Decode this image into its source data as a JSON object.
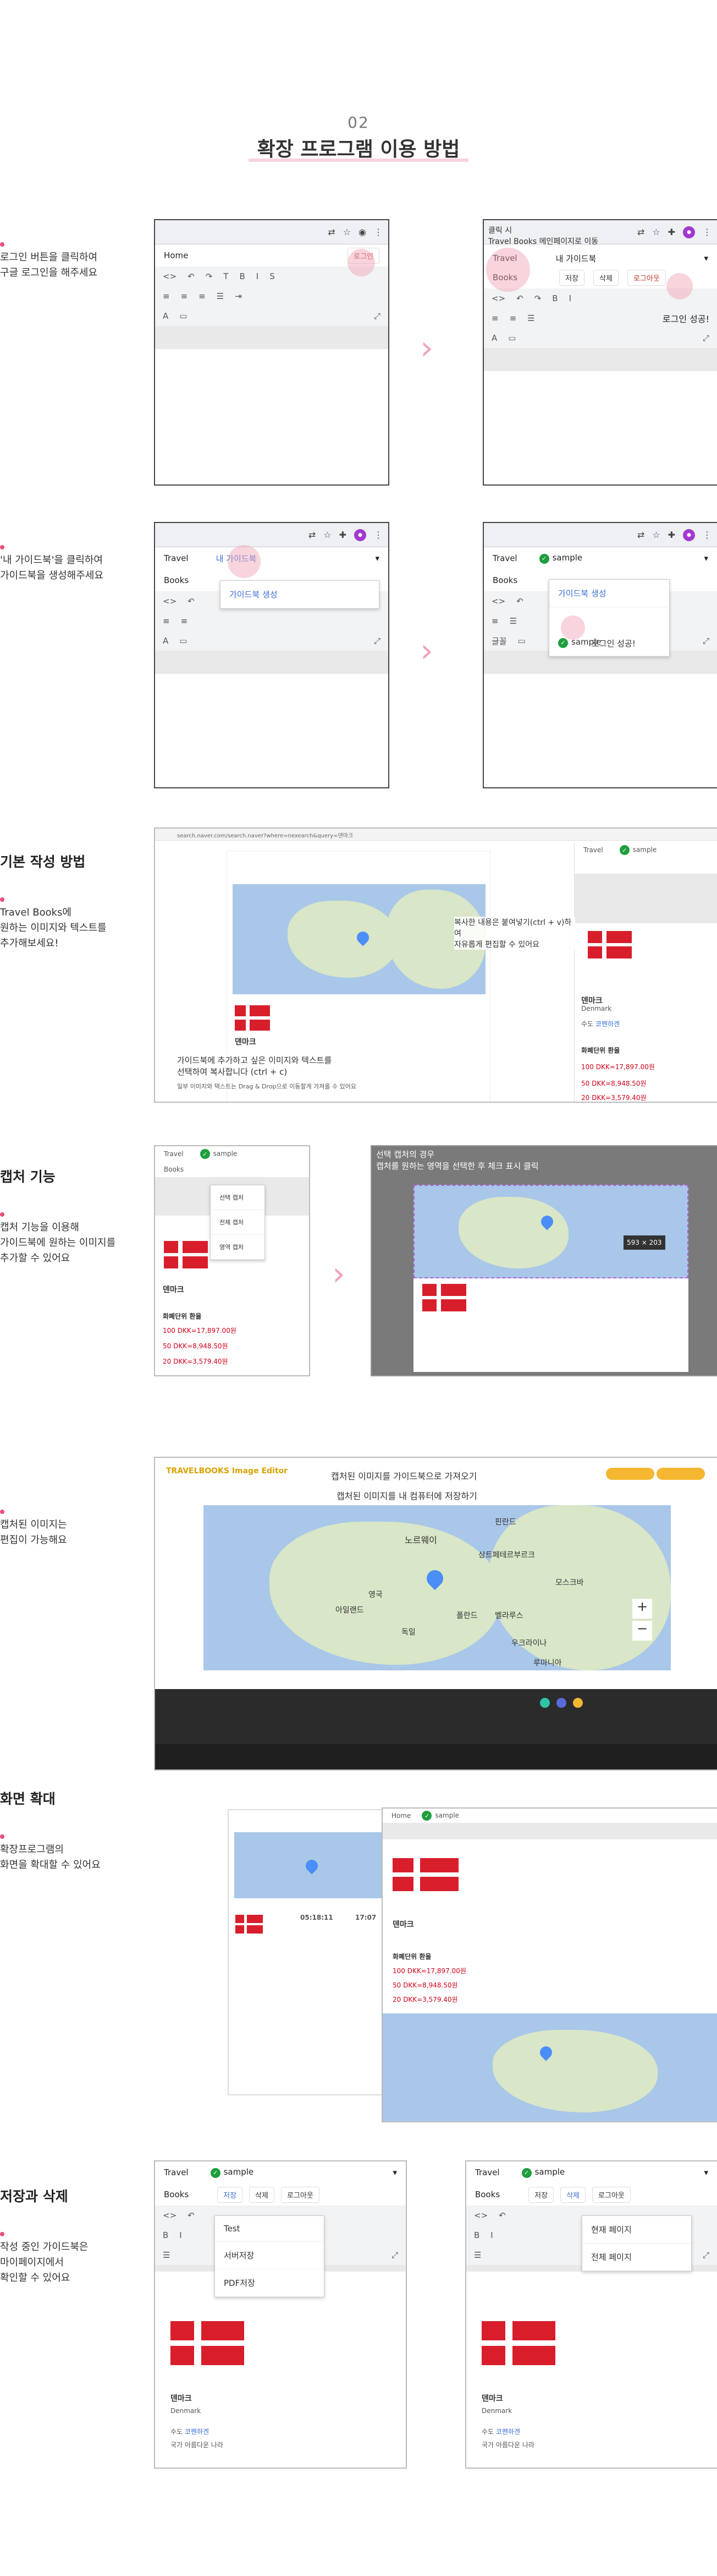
{
  "header": {
    "number": "02",
    "title": "확장 프로그램 이용 방법"
  },
  "step1": {
    "desc": "로그인 버튼을 클릭하여\n구글 로그인을 해주세요",
    "left": {
      "home": "Home",
      "login_btn": "로그인"
    },
    "right": {
      "note": "클릭 시\nTravel Books 메인페이지로 이동",
      "travel": "Travel",
      "books": "Books",
      "my_guide": "내 가이드북",
      "save": "저장",
      "delete": "삭제",
      "logout": "로그아웃",
      "success": "로그인 성공!"
    }
  },
  "step2": {
    "desc": "'내 가이드북'을 클릭하여\n가이드북을 생성해주세요",
    "left": {
      "travel": "Travel",
      "books": "Books",
      "my_guide": "내 가이드북",
      "create": "가이드북 생성"
    },
    "right": {
      "travel": "Travel",
      "books": "Books",
      "sample": "sample",
      "create": "가이드북 생성",
      "sample_item": "sample",
      "success": "로그인 성공!",
      "body_label": "글꼴"
    }
  },
  "step3": {
    "title": "기본 작성 방법",
    "desc": "Travel Books에\n원하는 이미지와 텍스트를\n추가해보세요!",
    "paste_note": "복사한 내용은 붙여넣기(ctrl + v)하여\n자유롭게 편집할 수 있어요",
    "copy_note": "가이드북에 추가하고 싶은 이미지와 텍스트를\n선택하여 복사합니다 (ctrl + c)",
    "copy_sub": "일부 이미지와 텍스트는 Drag & Drop으로 이동할게 가져올 수 있어요",
    "country": "덴마크",
    "country_en": "Denmark",
    "capital_label": "수도",
    "capital": "코펜하겐",
    "currency_title": "화폐단위 환율",
    "rates": [
      "100 DKK=17,897.00원",
      "50 DKK=8,948.50원",
      "20 DKK=3,579.40원"
    ],
    "url": "search.naver.com/search.naver?where=nexearch&query=덴마크"
  },
  "step4": {
    "title": "캡처 기능",
    "desc": "캡처 기능을 이용해\n가이드북에 원하는 이미지를\n추가할 수 있어요",
    "menu": [
      "선택 캡처",
      "전체 캡처",
      "영역 캡처"
    ],
    "tip": "선택 캡처의 경우\n캡처를 원하는 영역을 선택한 후 체크 표시 클릭",
    "size": "593 × 203",
    "country": "덴마크",
    "currency_title": "화폐단위 환율",
    "rates": [
      "100 DKK=17,897.00원",
      "50 DKK=8,948.50원",
      "20 DKK=3,579.40원"
    ]
  },
  "step5": {
    "desc": "캡처된 이미지는\n편집이 가능해요",
    "app_name": "TRAVELBOOKS Image Editor",
    "import_note": "캡처된 이미지를 가이드북으로 가져오기",
    "save_note": "캡처된 이미지를 내 컴퓨터에 저장하기",
    "cities": [
      "노르웨이",
      "핀란드",
      "상트페테르부르크",
      "영국",
      "아일랜드",
      "모스크바",
      "벨라루스",
      "폴란드",
      "우크라이나",
      "독일",
      "루마니아"
    ],
    "palette": [
      "#2ec4a6",
      "#5a6bd8",
      "#f5b731"
    ]
  },
  "step6": {
    "title": "화면 확대",
    "desc": "확장프로그램의\n화면을 확대할 수 있어요",
    "home": "Home",
    "sample": "sample",
    "country": "덴마크",
    "time1": "05:18:11",
    "time2": "17:07",
    "currency_title": "화폐단위 환율",
    "rates": [
      "100 DKK=17,897.00원",
      "50 DKK=8,948.50원",
      "20 DKK=3,579.40원"
    ]
  },
  "step7": {
    "title": "저장과 삭제",
    "desc": "작성 중인 가이드북은\n마이페이지에서\n확인할 수 있어요",
    "travel": "Travel",
    "books": "Books",
    "sample": "sample",
    "save": "저장",
    "delete": "삭제",
    "logout": "로그아웃",
    "save_menu": [
      "Test",
      "서버저장",
      "PDF저장"
    ],
    "delete_menu": [
      "현재 페이지",
      "전체 페이지"
    ],
    "country": "덴마크",
    "country_en": "Denmark",
    "capital_label": "수도",
    "capital": "코펜하겐",
    "nation_label": "국가",
    "nation": "아름다운 나라"
  },
  "colors": {
    "accent": "#e8507a",
    "pink_soft": "#f0a5b8",
    "brand_red": "#d81e2b"
  }
}
